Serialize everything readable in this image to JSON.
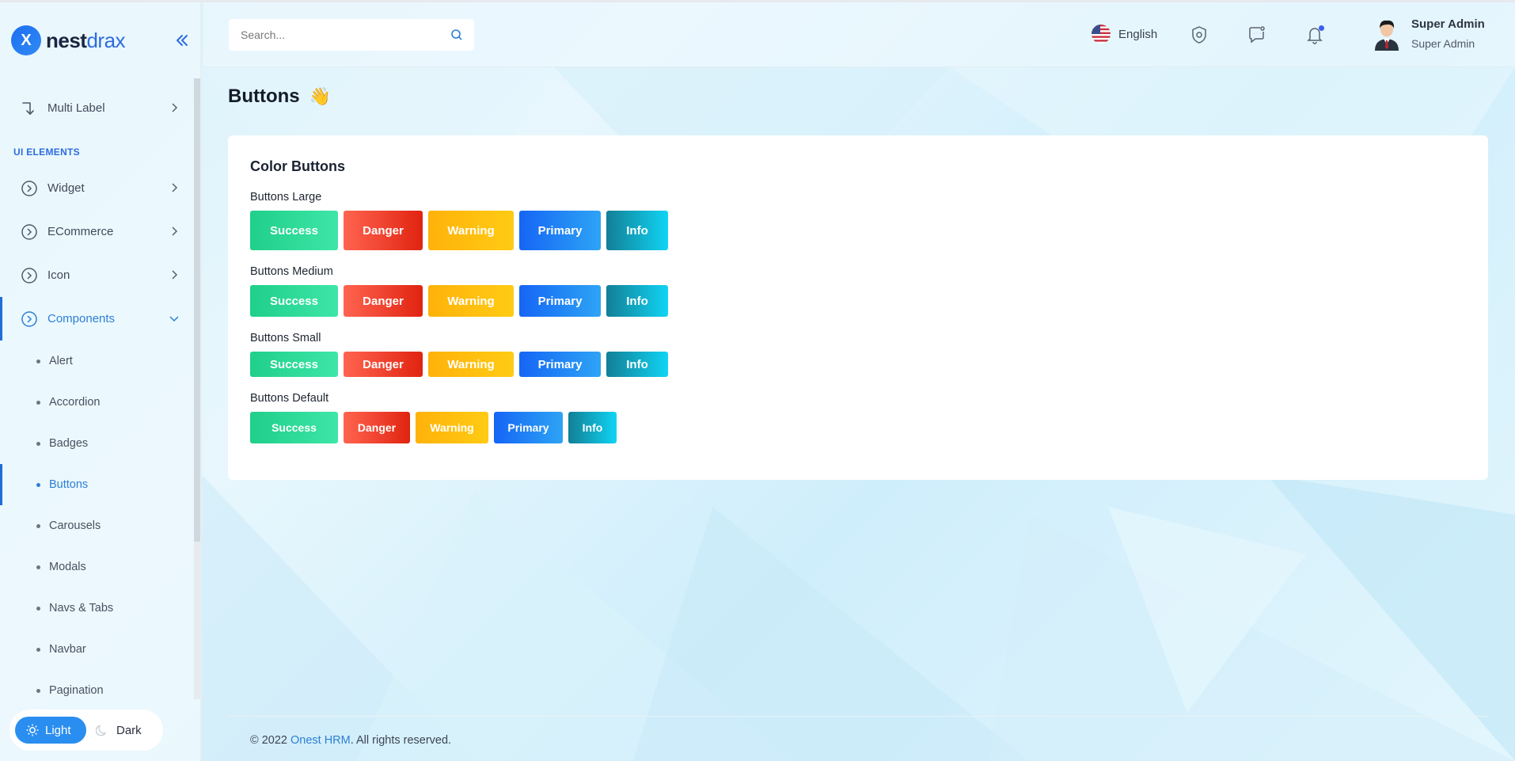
{
  "brand": {
    "logo_letter": "X",
    "name_bold": "nest",
    "name_light": "drax"
  },
  "sidebar": {
    "multi_label": "Multi Label",
    "section": "UI ELEMENTS",
    "items": [
      {
        "label": "Widget"
      },
      {
        "label": "ECommerce"
      },
      {
        "label": "Icon"
      },
      {
        "label": "Components"
      }
    ],
    "sub_items": [
      "Alert",
      "Accordion",
      "Badges",
      "Buttons",
      "Carousels",
      "Modals",
      "Navs & Tabs",
      "Navbar",
      "Pagination"
    ],
    "active_sub": "Buttons",
    "theme": {
      "light": "Light",
      "dark": "Dark"
    }
  },
  "header": {
    "search_placeholder": "Search...",
    "language": "English",
    "user": {
      "name": "Super Admin",
      "role": "Super Admin"
    }
  },
  "page": {
    "title": "Buttons",
    "title_emoji": "👋",
    "card_title": "Color Buttons",
    "groups": [
      {
        "label": "Buttons Large",
        "buttons": [
          "Success",
          "Danger",
          "Warning",
          "Primary",
          "Info"
        ]
      },
      {
        "label": "Buttons Medium",
        "buttons": [
          "Success",
          "Danger",
          "Warning",
          "Primary",
          "Info"
        ]
      },
      {
        "label": "Buttons Small",
        "buttons": [
          "Success",
          "Danger",
          "Warning",
          "Primary",
          "Info"
        ]
      },
      {
        "label": "Buttons Default",
        "buttons": [
          "Success",
          "Danger",
          "Warning",
          "Primary",
          "Info"
        ]
      }
    ]
  },
  "footer": {
    "prefix": "© 2022 ",
    "link": "Onest HRM",
    "suffix": ". All rights reserved."
  },
  "colors": {
    "accent": "#2d7fd4",
    "success": "#1fcf8a",
    "danger": "#e02410",
    "warning": "#ffb20a",
    "primary": "#1565f5",
    "info": "#10d4f4"
  }
}
